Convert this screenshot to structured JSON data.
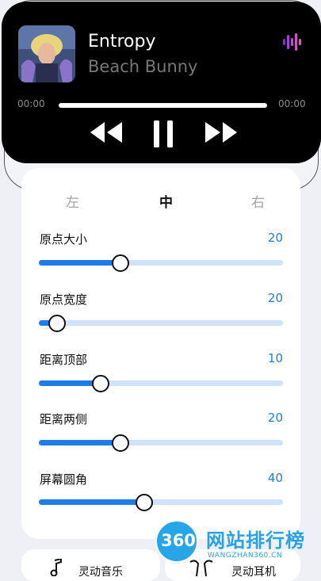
{
  "player": {
    "title": "Entropy",
    "artist": "Beach Bunny",
    "time_elapsed": "00:00",
    "time_total": "00:00"
  },
  "tabs": [
    {
      "label": "左",
      "active": false
    },
    {
      "label": "中",
      "active": true
    },
    {
      "label": "右",
      "active": false
    }
  ],
  "settings": [
    {
      "label": "原点大小",
      "value": "20",
      "level": 0.33
    },
    {
      "label": "原点宽度",
      "value": "20",
      "level": 0.07
    },
    {
      "label": "距离顶部",
      "value": "10",
      "level": 0.25
    },
    {
      "label": "距离两侧",
      "value": "20",
      "level": 0.33
    },
    {
      "label": "屏幕圆角",
      "value": "40",
      "level": 0.43
    }
  ],
  "bottom_cards": [
    {
      "label": "灵动音乐",
      "icon": "music-note-icon"
    },
    {
      "label": "灵动耳机",
      "icon": "earbuds-icon"
    }
  ],
  "watermark": {
    "badge": "360",
    "title": "网站排行榜",
    "subtitle": "WANGZHAN360.CN"
  },
  "colors": {
    "accent": "#1d7ce6",
    "track": "#cfe2f8",
    "player_bg": "#000000",
    "watermark": "#29a3e6"
  }
}
